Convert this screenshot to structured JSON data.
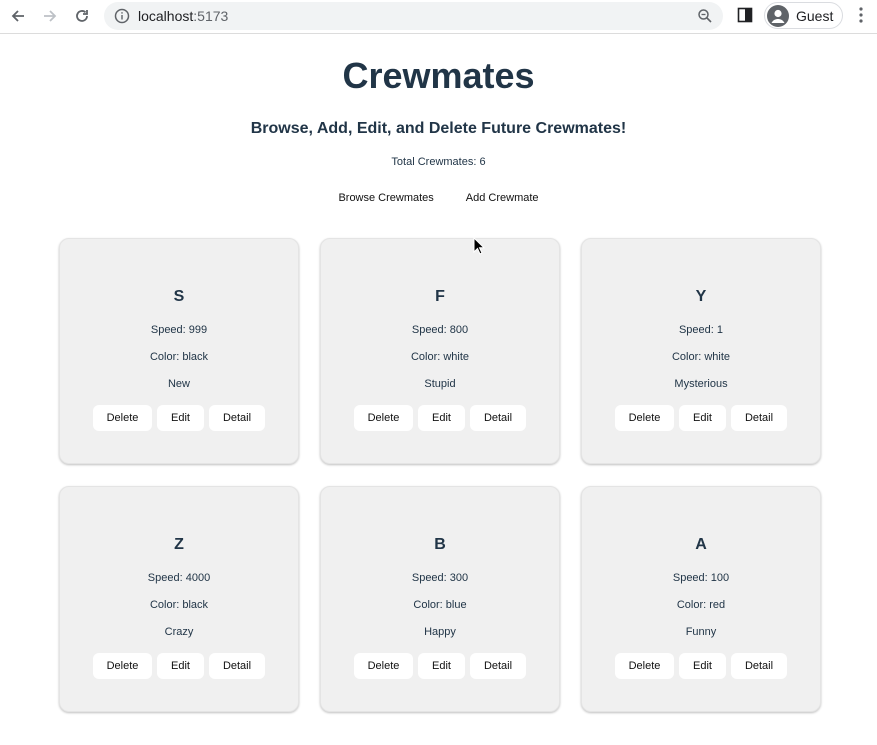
{
  "browser": {
    "url_host": "localhost",
    "url_port": ":5173",
    "profile_label": "Guest"
  },
  "page": {
    "title": "Crewmates",
    "subtitle": "Browse, Add, Edit, and Delete Future Crewmates!",
    "total": "Total Crewmates: 6",
    "nav": {
      "browse": "Browse Crewmates",
      "add": "Add Crewmate"
    }
  },
  "crewmates": [
    {
      "name": "S",
      "speed": "Speed: 999",
      "color": "Color: black",
      "category": "New"
    },
    {
      "name": "F",
      "speed": "Speed: 800",
      "color": "Color: white",
      "category": "Stupid"
    },
    {
      "name": "Y",
      "speed": "Speed: 1",
      "color": "Color: white",
      "category": "Mysterious"
    },
    {
      "name": "Z",
      "speed": "Speed: 4000",
      "color": "Color: black",
      "category": "Crazy"
    },
    {
      "name": "B",
      "speed": "Speed: 300",
      "color": "Color: blue",
      "category": "Happy"
    },
    {
      "name": "A",
      "speed": "Speed: 100",
      "color": "Color: red",
      "category": "Funny"
    }
  ],
  "card_actions": {
    "delete": "Delete",
    "edit": "Edit",
    "detail": "Detail"
  }
}
